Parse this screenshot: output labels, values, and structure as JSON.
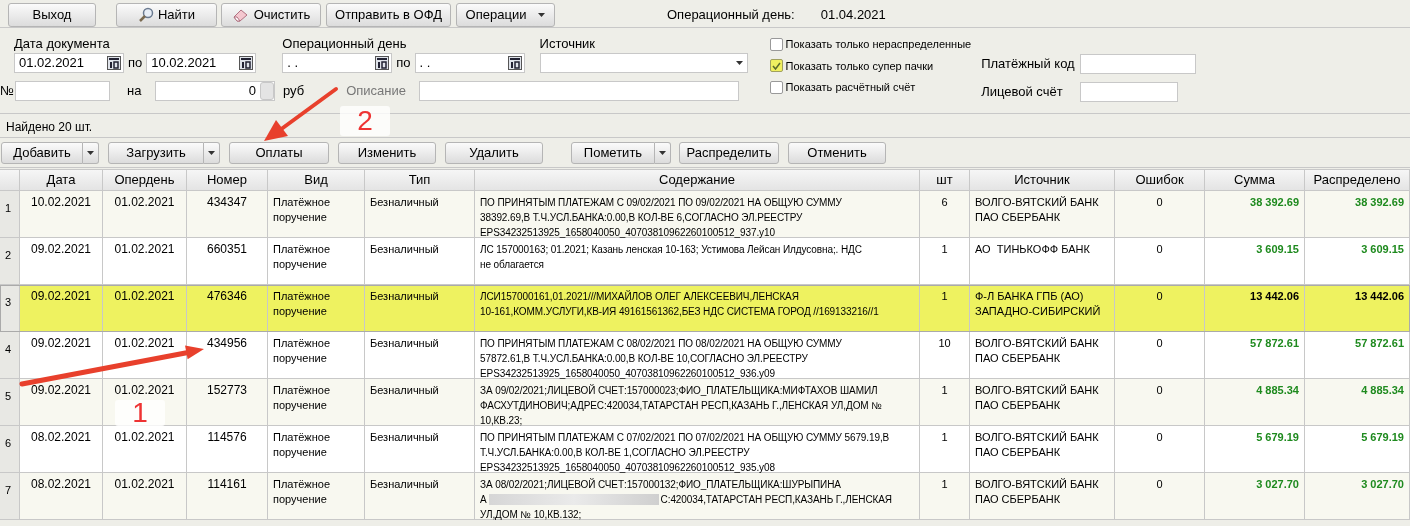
{
  "top_buttons": [
    {
      "label": "Выход",
      "kind": "plain"
    },
    {
      "label": "Найти",
      "kind": "search"
    },
    {
      "label": "Очистить",
      "kind": "eraser"
    },
    {
      "label": "Отправить в ОФД",
      "kind": "plain"
    },
    {
      "label": "Операции",
      "kind": "menu"
    }
  ],
  "operational_day": {
    "label": "Операционный день:",
    "value": "01.04.2021"
  },
  "filters": {
    "doc_date": {
      "label": "Дата документа",
      "from": "01.02.2021",
      "sep": "по",
      "to": "10.02.2021"
    },
    "op_day": {
      "label": "Операционный день",
      "from": ". .",
      "sep": "по",
      "to": ". ."
    },
    "source": {
      "label": "Источник"
    },
    "number": {
      "label": "№"
    },
    "amount": {
      "label": "на",
      "value": "0",
      "unit": "руб"
    },
    "description": {
      "label": "Описание"
    },
    "checkboxes": [
      {
        "label": "Показать только нераспределенные",
        "checked": false
      },
      {
        "label": "Показать только супер пачки",
        "checked": true
      },
      {
        "label": "Показать расчётный счёт",
        "checked": false
      }
    ],
    "payment_code": {
      "label": "Платёжный код"
    },
    "personal_account": {
      "label": "Лицевой счёт"
    }
  },
  "found": "Найдено 20 шт.",
  "toolbar": [
    {
      "label": "Добавить",
      "kind": "split"
    },
    {
      "label": "Загрузить",
      "kind": "split"
    },
    {
      "label": "Оплаты",
      "kind": "plain"
    },
    {
      "label": "Изменить",
      "kind": "plain"
    },
    {
      "label": "Удалить",
      "kind": "plain"
    },
    {
      "label": "Пометить",
      "kind": "split"
    },
    {
      "label": "Распределить",
      "kind": "plain"
    },
    {
      "label": "Отменить",
      "kind": "plain"
    }
  ],
  "table": {
    "columns": [
      "Дата",
      "Опердень",
      "Номер",
      "Вид",
      "Тип",
      "Содержание",
      "шт",
      "Источник",
      "Ошибок",
      "Сумма",
      "Распределено"
    ],
    "rows": [
      {
        "n": "1",
        "date": "10.02.2021",
        "opday": "01.02.2021",
        "number": "434347",
        "kind": [
          "Платёжное",
          "поручение"
        ],
        "type": "Безналичный",
        "content": [
          "ПО ПРИНЯТЫМ ПЛАТЕЖАМ С 09/02/2021 ПО 09/02/2021 НА ОБЩУЮ СУММУ",
          "38392.69,В Т.Ч.УСЛ.БАНКА:0.00,В КОЛ-ВЕ 6,СОГЛАСНО ЭЛ.РЕЕСТРУ",
          "EPS34232513925_1658040050_40703810962260100512_937.y10"
        ],
        "count": "6",
        "source": [
          "ВОЛГО-ВЯТСКИЙ БАНК",
          "ПАО СБЕРБАНК"
        ],
        "errors": "0",
        "sum": "38 392.69",
        "distributed": "38 392.69",
        "selected": false
      },
      {
        "n": "2",
        "date": "09.02.2021",
        "opday": "01.02.2021",
        "number": "660351",
        "kind": [
          "Платёжное",
          "поручение"
        ],
        "type": "Безналичный",
        "content": [
          "ЛС 157000163; 01.2021; Казань ленская 10-163; Устимова Лейсан Илдусовна;. НДС",
          "не облагается"
        ],
        "count": "1",
        "source": [
          "АО  ТИНЬКОФФ БАНК"
        ],
        "errors": "0",
        "sum": "3 609.15",
        "distributed": "3 609.15",
        "selected": false
      },
      {
        "n": "3",
        "date": "09.02.2021",
        "opday": "01.02.2021",
        "number": "476346",
        "kind": [
          "Платёжное",
          "поручение"
        ],
        "type": "Безналичный",
        "content": [
          "ЛСИ157000161,01.2021///МИХАЙЛОВ ОЛЕГ АЛЕКСЕЕВИЧ,ЛЕНСКАЯ",
          "10-161,КОММ.УСЛУГИ,КВ-ИЯ 49161561362,БЕЗ НДС СИСТЕМА ГОРОД //169133216//1"
        ],
        "count": "1",
        "source": [
          "Ф-Л БАНКА ГПБ (АО)",
          "ЗАПАДНО-СИБИРСКИЙ"
        ],
        "errors": "0",
        "sum": "13 442.06",
        "distributed": "13 442.06",
        "selected": true
      },
      {
        "n": "4",
        "date": "09.02.2021",
        "opday": "01.02.2021",
        "number": "434956",
        "kind": [
          "Платёжное",
          "поручение"
        ],
        "type": "Безналичный",
        "content": [
          "ПО ПРИНЯТЫМ ПЛАТЕЖАМ С 08/02/2021 ПО 08/02/2021 НА ОБЩУЮ СУММУ",
          "57872.61,В Т.Ч.УСЛ.БАНКА:0.00,В КОЛ-ВЕ 10,СОГЛАСНО ЭЛ.РЕЕСТРУ",
          "EPS34232513925_1658040050_40703810962260100512_936.y09"
        ],
        "count": "10",
        "source": [
          "ВОЛГО-ВЯТСКИЙ БАНК",
          "ПАО СБЕРБАНК"
        ],
        "errors": "0",
        "sum": "57 872.61",
        "distributed": "57 872.61",
        "selected": false
      },
      {
        "n": "5",
        "date": "09.02.2021",
        "opday": "01.02.2021",
        "number": "152773",
        "kind": [
          "Платёжное",
          "поручение"
        ],
        "type": "Безналичный",
        "content": [
          "ЗА 09/02/2021;ЛИЦЕВОЙ СЧЕТ:157000023;ФИО_ПЛАТЕЛЬЩИКА:МИФТАХОВ ШАМИЛ",
          "ФАСХУТДИНОВИЧ;АДРЕС:420034,ТАТАРСТАН РЕСП,КАЗАНЬ Г.,ЛЕНСКАЯ УЛ,ДОМ №",
          "10,КВ.23;"
        ],
        "count": "1",
        "source": [
          "ВОЛГО-ВЯТСКИЙ БАНК",
          "ПАО СБЕРБАНК"
        ],
        "errors": "0",
        "sum": "4 885.34",
        "distributed": "4 885.34",
        "selected": false
      },
      {
        "n": "6",
        "date": "08.02.2021",
        "opday": "01.02.2021",
        "number": "114576",
        "kind": [
          "Платёжное",
          "поручение"
        ],
        "type": "Безналичный",
        "content": [
          "ПО ПРИНЯТЫМ ПЛАТЕЖАМ С 07/02/2021 ПО 07/02/2021 НА ОБЩУЮ СУММУ 5679.19,В",
          "Т.Ч.УСЛ.БАНКА:0.00,В КОЛ-ВЕ 1,СОГЛАСНО ЭЛ.РЕЕСТРУ",
          "EPS34232513925_1658040050_40703810962260100512_935.y08"
        ],
        "count": "1",
        "source": [
          "ВОЛГО-ВЯТСКИЙ БАНК",
          "ПАО СБЕРБАНК"
        ],
        "errors": "0",
        "sum": "5 679.19",
        "distributed": "5 679.19",
        "selected": false
      },
      {
        "n": "7",
        "date": "08.02.2021",
        "opday": "01.02.2021",
        "number": "114161",
        "kind": [
          "Платёжное",
          "поручение"
        ],
        "type": "Безналичный",
        "content": [
          "ЗА 08/02/2021;ЛИЦЕВОЙ СЧЕТ:157000132;ФИО_ПЛАТЕЛЬЩИКА:ШУРЫПИНА",
          {
            "kind": "redacted",
            "parts": [
              "А",
              "С:420034,ТАТАРСТАН РЕСП,КАЗАНЬ Г.,ЛЕНСКАЯ"
            ]
          },
          "УЛ,ДОМ № 10,КВ.132;"
        ],
        "count": "1",
        "source": [
          "ВОЛГО-ВЯТСКИЙ БАНК",
          "ПАО СБЕРБАНК"
        ],
        "errors": "0",
        "sum": "3 027.70",
        "distributed": "3 027.70",
        "selected": false
      }
    ]
  },
  "annotations": [
    {
      "label": "1"
    },
    {
      "label": "2"
    }
  ]
}
